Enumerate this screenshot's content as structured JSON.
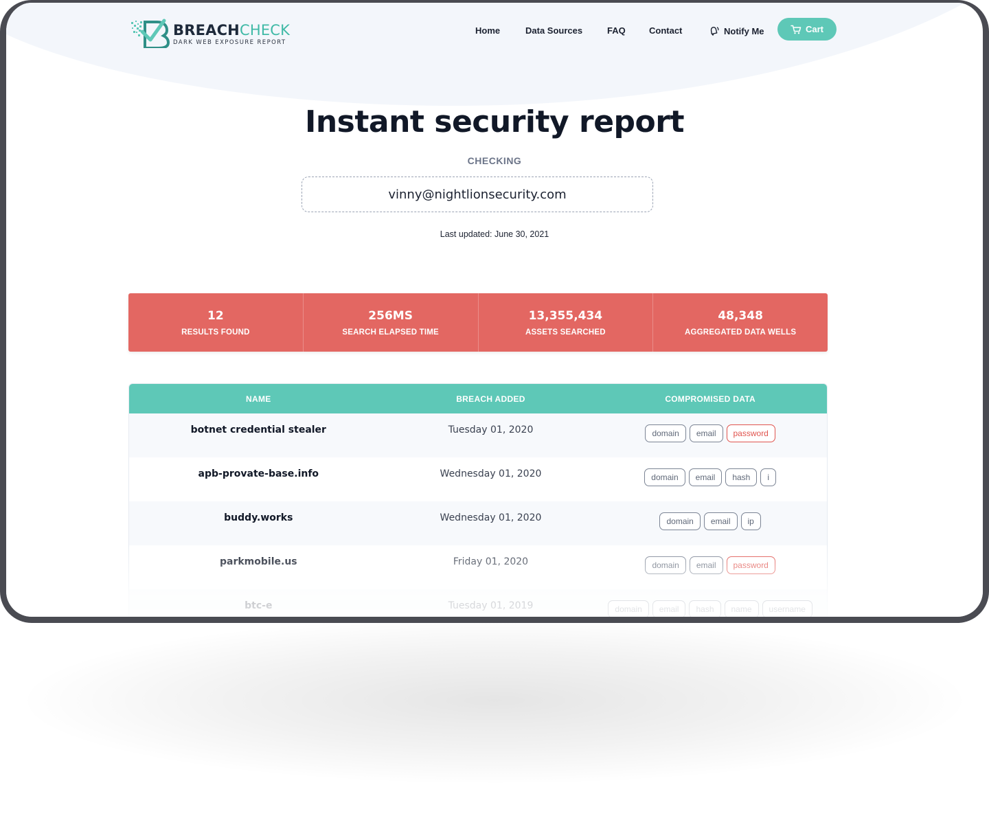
{
  "brand": {
    "name_part1": "BREACH",
    "name_part2": "CHECK",
    "tagline": "DARK WEB EXPOSURE REPORT",
    "accent_color": "#5ec8b7",
    "alert_color": "#e36762"
  },
  "nav": {
    "items": [
      "Home",
      "Data Sources",
      "FAQ",
      "Contact"
    ],
    "notify_label": "Notify Me",
    "notify_icon": "bell-icon",
    "cart_label": "Cart",
    "cart_icon": "cart-icon"
  },
  "hero": {
    "title": "Instant security report",
    "checking_label": "CHECKING",
    "email": "vinny@nightlionsecurity.com",
    "last_updated": "Last updated: June 30, 2021"
  },
  "stats": [
    {
      "value": "12",
      "label": "RESULTS FOUND"
    },
    {
      "value": "256MS",
      "label": "SEARCH ELAPSED TIME"
    },
    {
      "value": "13,355,434",
      "label": "ASSETS SEARCHED"
    },
    {
      "value": "48,348",
      "label": "AGGREGATED DATA WELLS"
    }
  ],
  "table": {
    "headers": [
      "NAME",
      "BREACH ADDED",
      "COMPROMISED DATA"
    ],
    "rows": [
      {
        "name": "botnet credential stealer",
        "date": "Tuesday 01, 2020",
        "tags": [
          {
            "label": "domain",
            "alert": false
          },
          {
            "label": "email",
            "alert": false
          },
          {
            "label": "password",
            "alert": true
          }
        ]
      },
      {
        "name": "apb-provate-base.info",
        "date": "Wednesday 01, 2020",
        "tags": [
          {
            "label": "domain",
            "alert": false
          },
          {
            "label": "email",
            "alert": false
          },
          {
            "label": "hash",
            "alert": false
          },
          {
            "label": "i",
            "alert": false
          }
        ]
      },
      {
        "name": "buddy.works",
        "date": "Wednesday 01, 2020",
        "tags": [
          {
            "label": "domain",
            "alert": false
          },
          {
            "label": "email",
            "alert": false
          },
          {
            "label": "ip",
            "alert": false
          }
        ]
      },
      {
        "name": "parkmobile.us",
        "date": "Friday 01, 2020",
        "tags": [
          {
            "label": "domain",
            "alert": false
          },
          {
            "label": "email",
            "alert": false
          },
          {
            "label": "password",
            "alert": true
          }
        ]
      },
      {
        "name": "btc-e",
        "date": "Tuesday 01, 2019",
        "tags": [
          {
            "label": "domain",
            "alert": false
          },
          {
            "label": "email",
            "alert": false
          },
          {
            "label": "hash",
            "alert": false
          },
          {
            "label": "name",
            "alert": false
          },
          {
            "label": "username",
            "alert": false
          }
        ]
      }
    ]
  }
}
